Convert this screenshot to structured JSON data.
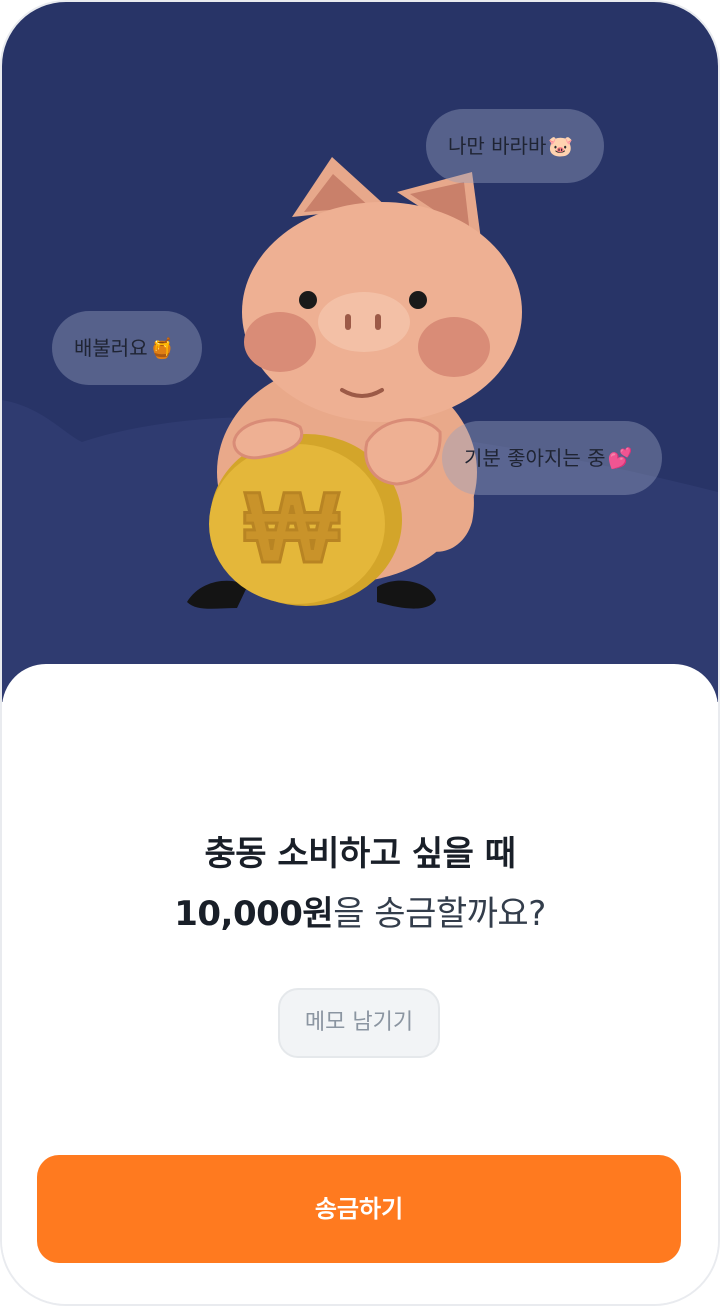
{
  "bubbles": {
    "top_right": {
      "text": "나만 바라바",
      "emoji": "🐷"
    },
    "left": {
      "text": "배불러요",
      "emoji": "🍯"
    },
    "right": {
      "text": "기분 좋아지는 중",
      "emoji": "💕"
    }
  },
  "coin": {
    "symbol": "₩"
  },
  "headline": {
    "line1": "충동 소비하고 싶을 때",
    "amount": "10,000원",
    "line2_rest": "을 송금할까요?"
  },
  "memo_button": {
    "label": "메모 남기기"
  },
  "send_button": {
    "label": "송금하기"
  },
  "colors": {
    "hero_background": "#283467",
    "accent": "#ff7a1f"
  }
}
